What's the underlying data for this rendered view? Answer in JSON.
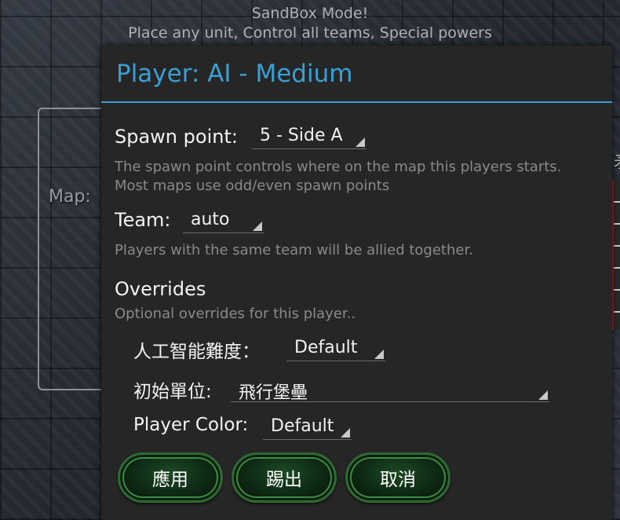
{
  "background": {
    "mode_title": "SandBox Mode!",
    "mode_subtitle": "Place any unit, Control all teams, Special powers",
    "map_label": "Map:",
    "right_edge_char": "矛"
  },
  "dialog": {
    "title": "Player: AI - Medium",
    "spawn": {
      "label": "Spawn point:",
      "value": "5 - Side A",
      "hint_line1": "The spawn point controls where on the map this players starts.",
      "hint_line2": "Most maps use odd/even spawn points"
    },
    "team": {
      "label": "Team:",
      "value": "auto",
      "hint": "Players with the same team will be allied together."
    },
    "overrides": {
      "label": "Overrides",
      "hint": "Optional overrides for this player..",
      "ai_difficulty": {
        "label": "人工智能難度：",
        "value": "Default"
      },
      "start_unit": {
        "label": "初始單位:",
        "value": "飛行堡壘"
      },
      "player_color": {
        "label": "Player Color:",
        "value": "Default"
      }
    },
    "buttons": {
      "apply": "應用",
      "kick": "踢出",
      "cancel": "取消"
    }
  },
  "colors": {
    "accent": "#3a9fd3",
    "dialog_bg": "#262626",
    "button_green": "#0d2813"
  }
}
